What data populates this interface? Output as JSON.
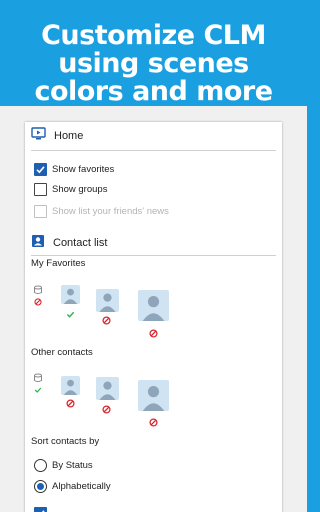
{
  "hero": {
    "line1": "Customize CLM",
    "line2": "using scenes",
    "line3": "colors and more"
  },
  "settings": {
    "home": {
      "title": "Home",
      "options": [
        {
          "label": "Show favorites",
          "checked": true,
          "enabled": true
        },
        {
          "label": "Show groups",
          "checked": false,
          "enabled": true
        },
        {
          "label": "Show list your friends' news",
          "checked": false,
          "enabled": false
        }
      ]
    },
    "contact_list": {
      "title": "Contact list",
      "favorites_label": "My Favorites",
      "others_label": "Other contacts",
      "sort_label": "Sort contacts by",
      "sort_options": [
        {
          "label": "By Status",
          "selected": false
        },
        {
          "label": "Alphabetically",
          "selected": true
        }
      ]
    }
  },
  "colors": {
    "hero_bg": "#1aa0e0",
    "checkbox": "#1e5fb0",
    "online": "#2db34a",
    "blocked": "#d9262e"
  }
}
